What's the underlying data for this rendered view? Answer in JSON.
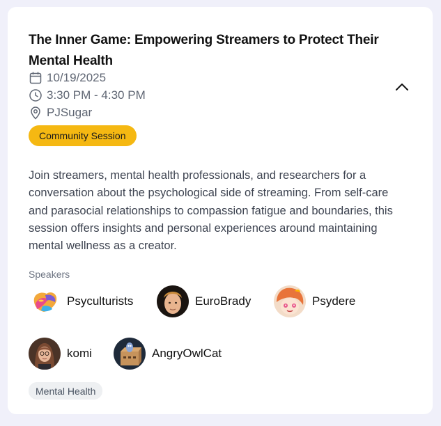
{
  "session": {
    "title": "The Inner Game: Empowering Streamers to Protect Their Mental Health",
    "date": "10/19/2025",
    "time": "3:30 PM - 4:30 PM",
    "location": "PJSugar",
    "badge": "Community Session",
    "description": "Join streamers, mental health professionals, and researchers for a conversation about the psychological side of streaming. From self-care and parasocial relationships to compassion fatigue and boundaries, this session offers insights and personal experiences around maintaining mental wellness as a creator.",
    "speakers_label": "Speakers",
    "speakers": [
      {
        "name": "Psyculturists"
      },
      {
        "name": "EuroBrady"
      },
      {
        "name": "Psydere"
      },
      {
        "name": "komi"
      },
      {
        "name": "AngryOwlCat"
      }
    ],
    "tags": [
      "Mental Health"
    ]
  },
  "icons": {
    "date": "calendar-icon",
    "time": "clock-icon",
    "location": "map-pin-icon",
    "toggle": "chevron-up-icon"
  },
  "colors": {
    "page_background": "#f0f0fa",
    "card_background": "#ffffff",
    "badge_background": "#f5b812",
    "tag_background": "#eef0f2",
    "meta_text": "#5f6673"
  }
}
